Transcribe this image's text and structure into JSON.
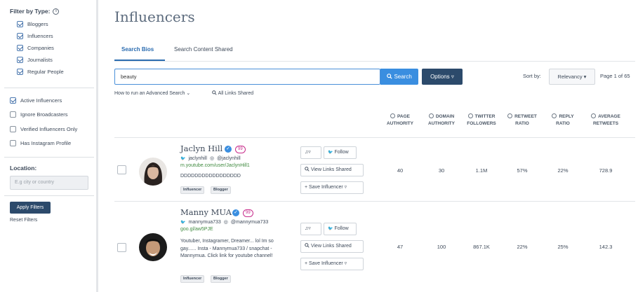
{
  "sidebar": {
    "filter_title": "Filter by Type:",
    "types": [
      {
        "label": "Bloggers",
        "checked": true
      },
      {
        "label": "Influencers",
        "checked": true
      },
      {
        "label": "Companies",
        "checked": true
      },
      {
        "label": "Journalists",
        "checked": true
      },
      {
        "label": "Regular People",
        "checked": true
      }
    ],
    "options": [
      {
        "label": "Active Influencers",
        "checked": true
      },
      {
        "label": "Ignore Broadcasters",
        "checked": false
      },
      {
        "label": "Verified Influencers Only",
        "checked": false
      },
      {
        "label": "Has Instagram Profile",
        "checked": false
      }
    ],
    "location_label": "Location:",
    "location_placeholder": "E.g city or country",
    "apply_label": "Apply Filters",
    "reset_label": "Reset Filters"
  },
  "main": {
    "title": "Influencers",
    "tabs": [
      "Search Bios",
      "Search Content Shared"
    ],
    "search_value": "beauty",
    "search_button": "Search",
    "options_button": "Options",
    "sort_label": "Sort by:",
    "sort_value": "Relevancy",
    "page_info": "Page 1 of 65",
    "advanced_link": "How to run an Advanced Search",
    "links_shared": "All Links Shared",
    "columns": [
      {
        "l1": "PAGE",
        "l2": "AUTHORITY"
      },
      {
        "l1": "DOMAIN",
        "l2": "AUTHORITY"
      },
      {
        "l1": "TWITTER",
        "l2": "FOLLOWERS"
      },
      {
        "l1": "RETWEET",
        "l2": "RATIO"
      },
      {
        "l1": "REPLY",
        "l2": "RATIO"
      },
      {
        "l1": "AVERAGE",
        "l2": "RETWEETS"
      }
    ],
    "follow_label": "Follow",
    "view_links_label": "View Links Shared",
    "save_label": "Save Influencer"
  },
  "influencers": [
    {
      "name": "Jaclyn Hill",
      "score": "99",
      "twitter": "jaclynhill",
      "instagram": "@jaclynhill",
      "url": "m.youtube.com/user/JaclynHill1",
      "bio": "DDDDDDDDDDDDDDDDD",
      "tags": [
        "Influencer",
        "Blogger"
      ],
      "metrics": [
        "40",
        "30",
        "1.1M",
        "57%",
        "22%",
        "728.9"
      ]
    },
    {
      "name": "Manny MUA",
      "score": "99",
      "twitter": "mannymua733",
      "instagram": "@mannymua733",
      "url": "goo.gl/aw5PJE",
      "bio": "Youtuber, Instagramer, Dreamer... lol Im so gay...... Insta - Mannymua733 / snapchat - Mannymua. Click link for youtube channel!",
      "tags": [
        "Influencer",
        "Blogger"
      ],
      "metrics": [
        "47",
        "100",
        "867.1K",
        "22%",
        "25%",
        "142.3"
      ]
    }
  ]
}
